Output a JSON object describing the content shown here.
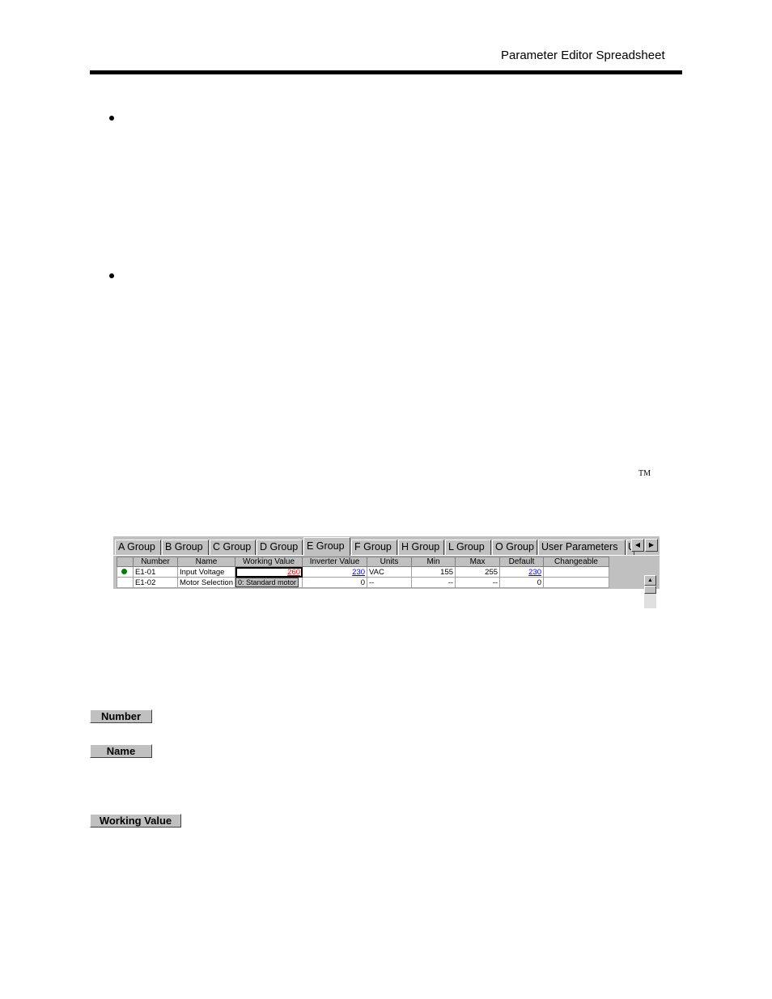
{
  "header": {
    "title": "Parameter Editor Spreadsheet"
  },
  "trademark": "TM",
  "grid": {
    "tabs": [
      "A Group",
      "B Group",
      "C Group",
      "D Group",
      "E Group",
      "F Group",
      "H Group",
      "L Group",
      "O Group",
      "User Parameters",
      "U"
    ],
    "active_tab": "E Group",
    "columns": [
      "",
      "Number",
      "Name",
      "Working Value",
      "Inverter Value",
      "Units",
      "Min",
      "Max",
      "Default",
      "Changeable"
    ],
    "rows": [
      {
        "number": "E1-01",
        "name": "Input Voltage",
        "working_value": "260",
        "inverter_value": "230",
        "units": "VAC",
        "min": "155",
        "max": "255",
        "default": "230",
        "changeable": ""
      },
      {
        "number": "E1-02",
        "name": "Motor Selection",
        "working_value": "0: Standard motor",
        "inverter_value": "0",
        "units": "--",
        "min": "--",
        "max": "--",
        "default": "0",
        "changeable": ""
      }
    ]
  },
  "header_buttons": {
    "number": "Number",
    "name": "Name",
    "working_value": "Working Value"
  }
}
